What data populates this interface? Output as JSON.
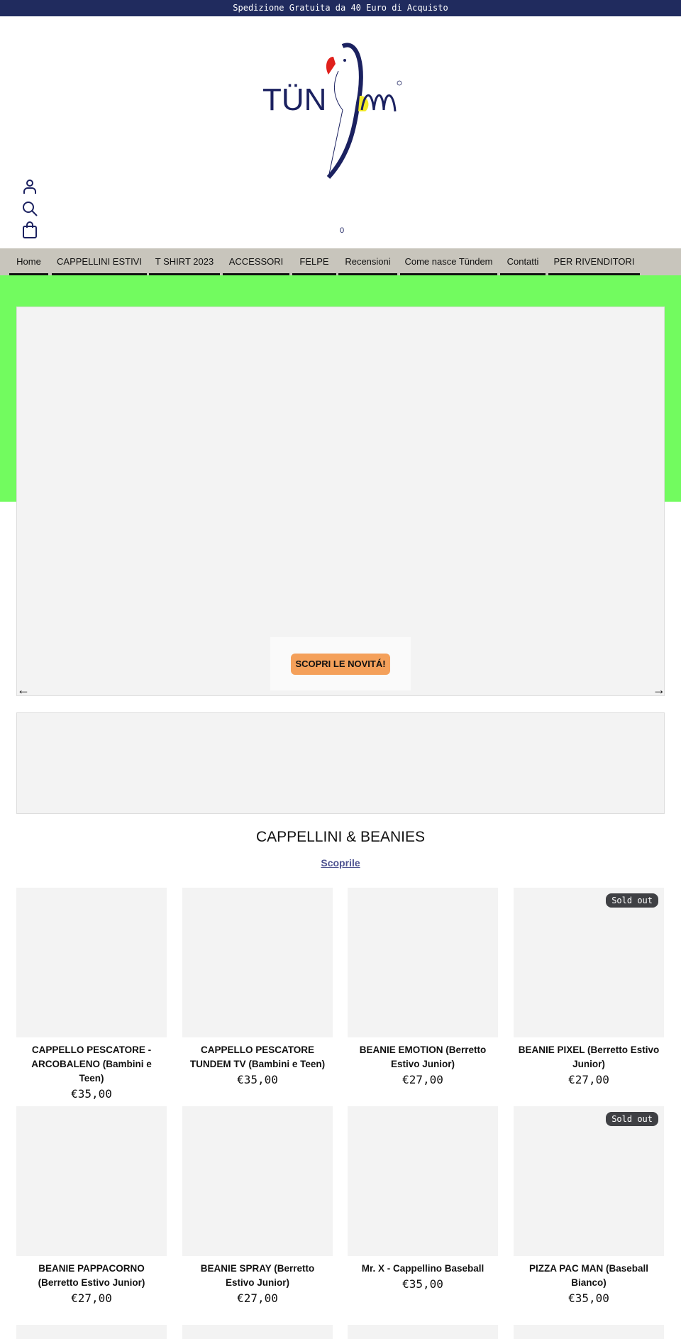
{
  "announcement": "Spedizione Gratuita da 40 Euro di Acquisto",
  "brand": {
    "logo_text": "Tündem",
    "colors": {
      "navy": "#1b2160",
      "red": "#e0201c",
      "yellow": "#f3ea2a"
    }
  },
  "header": {
    "cart_count": "0",
    "icons": [
      "account-icon",
      "search-icon",
      "cart-icon"
    ]
  },
  "nav": [
    {
      "label": "Home"
    },
    {
      "label": "CAPPELLINI ESTIVI"
    },
    {
      "label": "T SHIRT 2023"
    },
    {
      "label": "ACCESSORI"
    },
    {
      "label": "FELPE"
    },
    {
      "label": "Recensioni"
    },
    {
      "label": "Come nasce Tündem"
    },
    {
      "label": "Contatti"
    },
    {
      "label": "PER RIVENDITORI"
    }
  ],
  "hero": {
    "cta": "SCOPRI LE NOVITÁ!",
    "prev_icon": "arrow-left-icon",
    "next_icon": "arrow-right-icon"
  },
  "collection": {
    "title": "CAPPELLINI & BEANIES",
    "link": "Scoprile"
  },
  "products": [
    {
      "name": "CAPPELLO PESCATORE - ARCOBALENO (Bambini e Teen)",
      "price": "€35,00",
      "badge": ""
    },
    {
      "name": "CAPPELLO PESCATORE TUNDEM TV (Bambini e Teen)",
      "price": "€35,00",
      "badge": ""
    },
    {
      "name": "BEANIE EMOTION (Berretto Estivo Junior)",
      "price": "€27,00",
      "badge": ""
    },
    {
      "name": "BEANIE PIXEL (Berretto Estivo Junior)",
      "price": "€27,00",
      "badge": "Sold out"
    },
    {
      "name": "BEANIE PAPPACORNO (Berretto Estivo Junior)",
      "price": "€27,00",
      "badge": ""
    },
    {
      "name": "BEANIE SPRAY (Berretto Estivo Junior)",
      "price": "€27,00",
      "badge": ""
    },
    {
      "name": "Mr. X - Cappellino Baseball",
      "price": "€35,00",
      "badge": ""
    },
    {
      "name": "PIZZA PAC MAN (Baseball Bianco)",
      "price": "€35,00",
      "badge": "Sold out"
    }
  ]
}
